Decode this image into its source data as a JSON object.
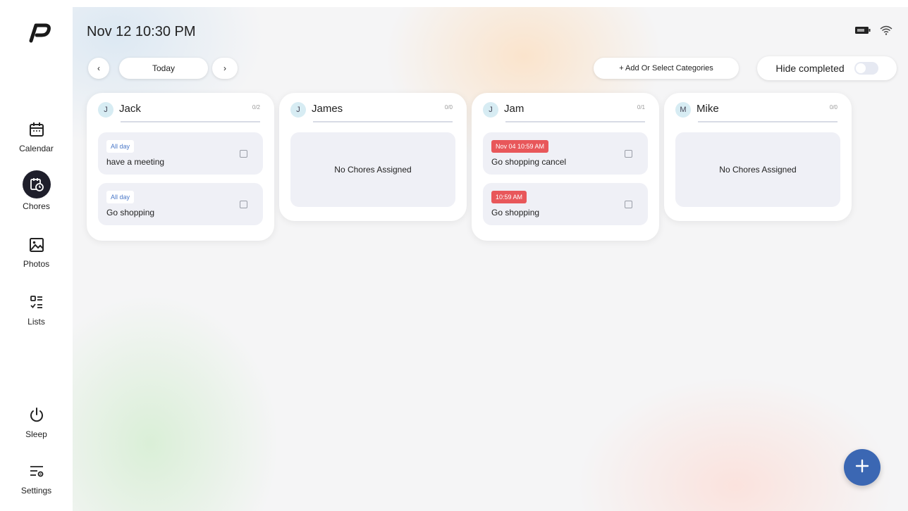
{
  "header": {
    "datetime": "Nov 12 10:30 PM",
    "battery_icon": "battery-icon",
    "wifi_icon": "wifi-icon"
  },
  "nav": {
    "items": [
      {
        "label": "Calendar",
        "icon": "calendar-icon",
        "active": false
      },
      {
        "label": "Chores",
        "icon": "chores-icon",
        "active": true
      },
      {
        "label": "Photos",
        "icon": "photo-icon",
        "active": false
      },
      {
        "label": "Lists",
        "icon": "list-icon",
        "active": false
      },
      {
        "label": "Sleep",
        "icon": "power-icon",
        "active": false
      },
      {
        "label": "Settings",
        "icon": "settings-icon",
        "active": false
      }
    ]
  },
  "toolbar": {
    "prev": "‹",
    "today": "Today",
    "next": "›",
    "add_categories": "+ Add Or Select Categories",
    "hide_completed": "Hide completed",
    "hide_completed_on": false
  },
  "members": [
    {
      "initial": "J",
      "name": "Jack",
      "count": "0/2",
      "chores": [
        {
          "tag": "All day",
          "tag_type": "allday",
          "title": "have a meeting"
        },
        {
          "tag": "All day",
          "tag_type": "allday",
          "title": "Go shopping"
        }
      ]
    },
    {
      "initial": "J",
      "name": "James",
      "count": "0/0",
      "empty_text": "No Chores Assigned"
    },
    {
      "initial": "J",
      "name": "Jam",
      "count": "0/1",
      "chores": [
        {
          "tag": "Nov 04 10:59 AM",
          "tag_type": "overdue",
          "title": "Go shopping cancel"
        },
        {
          "tag": "10:59 AM",
          "tag_type": "overdue",
          "title": "Go shopping"
        }
      ]
    },
    {
      "initial": "M",
      "name": "Mike",
      "count": "0/0",
      "empty_text": "No Chores Assigned"
    }
  ],
  "fab": {
    "label": "+"
  },
  "colors": {
    "accent": "#3b67b3",
    "overdue": "#e8575a",
    "allday_text": "#4a78c8"
  }
}
